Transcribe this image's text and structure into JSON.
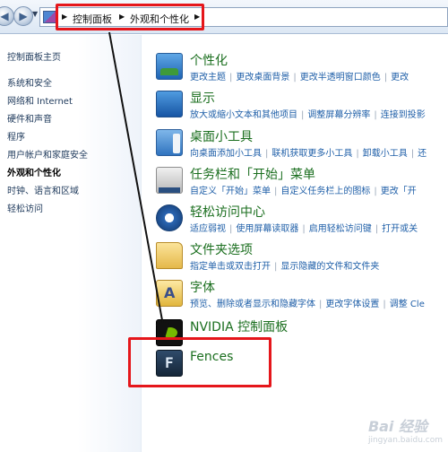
{
  "address_bar": {
    "breadcrumbs": [
      "控制面板",
      "外观和个性化"
    ]
  },
  "left_pane": {
    "links": [
      "控制面板主页",
      "系统和安全",
      "网络和 Internet",
      "硬件和声音",
      "程序",
      "用户帐户和家庭安全",
      "外观和个性化",
      "时钟、语言和区域",
      "轻松访问"
    ],
    "active_index": 6
  },
  "categories": [
    {
      "title": "个性化",
      "icon": "personalization-icon",
      "links": [
        "更改主题",
        "更改桌面背景",
        "更改半透明窗口颜色",
        "更改"
      ]
    },
    {
      "title": "显示",
      "icon": "display-icon",
      "links": [
        "放大或缩小文本和其他项目",
        "调整屏幕分辨率",
        "连接到投影"
      ]
    },
    {
      "title": "桌面小工具",
      "icon": "desktop-gadgets-icon",
      "links": [
        "向桌面添加小工具",
        "联机获取更多小工具",
        "卸载小工具",
        "还"
      ]
    },
    {
      "title": "任务栏和「开始」菜单",
      "icon": "taskbar-start-menu-icon",
      "links": [
        "自定义「开始」菜单",
        "自定义任务栏上的图标",
        "更改「开"
      ]
    },
    {
      "title": "轻松访问中心",
      "icon": "ease-of-access-icon",
      "links": [
        "适应弱视",
        "使用屏幕读取器",
        "启用轻松访问键",
        "打开或关"
      ]
    },
    {
      "title": "文件夹选项",
      "icon": "folder-options-icon",
      "links": [
        "指定单击或双击打开",
        "显示隐藏的文件和文件夹"
      ]
    },
    {
      "title": "字体",
      "icon": "fonts-icon",
      "links": [
        "预览、删除或者显示和隐藏字体",
        "更改字体设置",
        "调整 Cle"
      ]
    },
    {
      "title": "NVIDIA 控制面板",
      "icon": "nvidia-icon",
      "links": []
    },
    {
      "title": "Fences",
      "icon": "fences-icon",
      "links": []
    }
  ],
  "watermark": {
    "text": "Bai 经验",
    "sub": "jingyan.baidu.com"
  },
  "colors": {
    "title_green": "#1a6e1e",
    "link_blue": "#1f5fa8",
    "annotation_red": "#e5161b"
  }
}
